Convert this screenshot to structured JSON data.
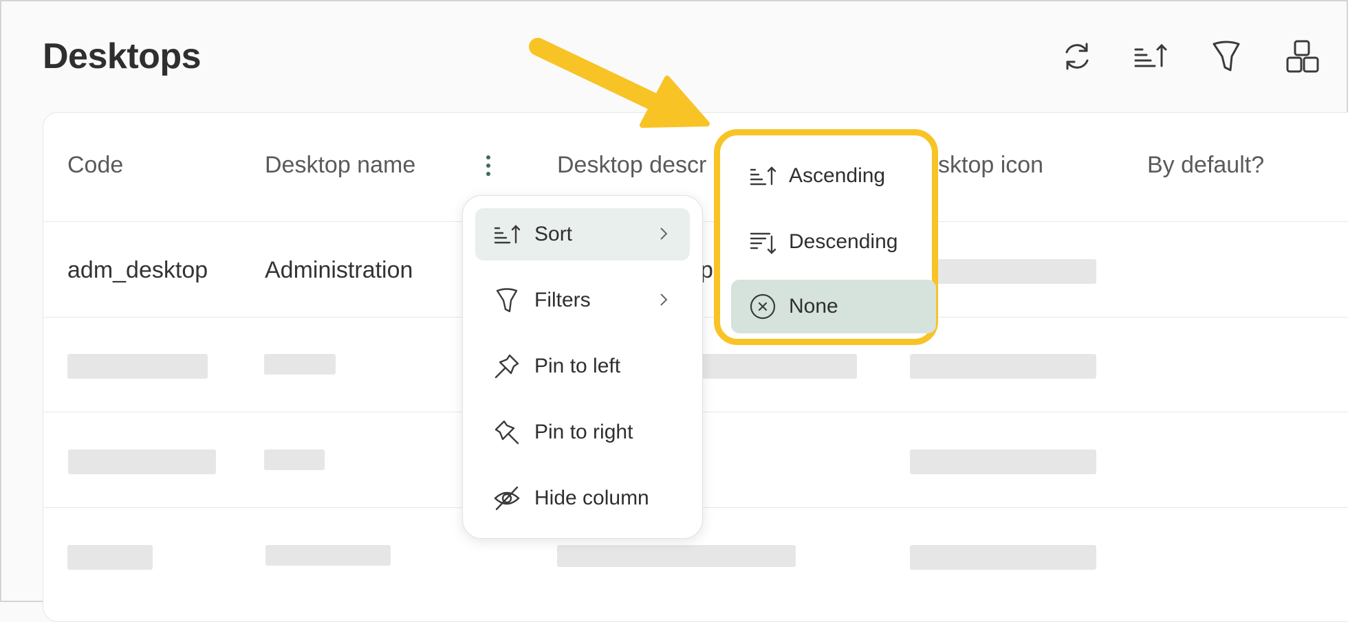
{
  "header": {
    "title": "Desktops"
  },
  "toolbar": {
    "buttons": [
      {
        "icon": "refresh-icon"
      },
      {
        "icon": "sort-icon"
      },
      {
        "icon": "filter-icon"
      },
      {
        "icon": "grid-view-icon"
      }
    ]
  },
  "table": {
    "columns": [
      "Code",
      "Desktop name",
      "Desktop descr",
      "sktop icon",
      "By default?"
    ],
    "rows": [
      {
        "code": "adm_desktop",
        "name": "Administration",
        "description_partial": "p"
      }
    ]
  },
  "context_menu": {
    "items": [
      {
        "label": "Sort",
        "icon": "sort-icon",
        "has_submenu": true,
        "active": true
      },
      {
        "label": "Filters",
        "icon": "filter-icon",
        "has_submenu": true
      },
      {
        "label": "Pin to left",
        "icon": "pin-left-icon"
      },
      {
        "label": "Pin to right",
        "icon": "pin-right-icon"
      },
      {
        "label": "Hide column",
        "icon": "eye-off-icon"
      }
    ]
  },
  "sort_submenu": {
    "items": [
      {
        "label": "Ascending",
        "icon": "sort-ascending-icon"
      },
      {
        "label": "Descending",
        "icon": "sort-descending-icon"
      },
      {
        "label": "None",
        "icon": "close-circle-icon",
        "active": true
      }
    ]
  },
  "colors": {
    "highlight": "#f8c325",
    "menu_active": "#e9efec",
    "submenu_active": "#d6e2dc",
    "accent_green": "#3f6b56"
  }
}
